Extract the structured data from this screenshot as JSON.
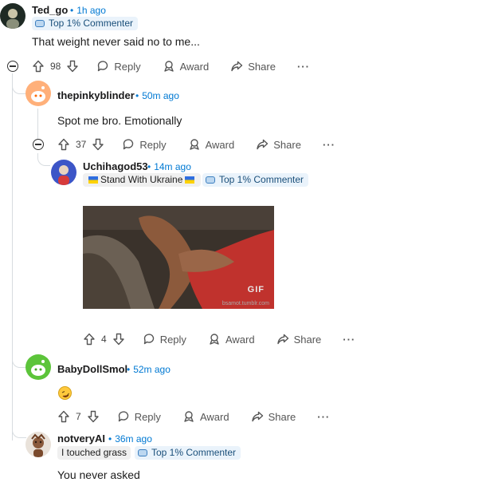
{
  "comments": [
    {
      "username": "Ted_go",
      "time": "1h ago",
      "badge": "Top 1% Commenter",
      "text": "That weight never said no to me...",
      "votes": "98",
      "reply": "Reply",
      "award": "Award",
      "share": "Share",
      "more": "···"
    },
    {
      "username": "thepinkyblinder",
      "time": "50m ago",
      "text": "Spot me bro. Emotionally",
      "votes": "37",
      "reply": "Reply",
      "award": "Award",
      "share": "Share",
      "more": "···"
    },
    {
      "username": "Uchihagod53",
      "time": "14m ago",
      "flair": "Stand With Ukraine",
      "badge": "Top 1% Commenter",
      "gif_label": "GIF",
      "gif_source": "bsamot.tumblr.com",
      "votes": "4",
      "reply": "Reply",
      "award": "Award",
      "share": "Share",
      "more": "···"
    },
    {
      "username": "BabyDollSmol",
      "time": "52m ago",
      "emoji": "rolling-on-floor-laughing-emoji",
      "votes": "7",
      "reply": "Reply",
      "award": "Award",
      "share": "Share",
      "more": "···"
    },
    {
      "username": "notveryAI",
      "time": "36m ago",
      "flair": "I touched grass",
      "badge": "Top 1% Commenter",
      "text": "You never asked"
    }
  ],
  "colors": {
    "time": "#0079d3",
    "badge_bg": "#eaf3fb",
    "thread_line": "#d7dce0"
  },
  "icons": [
    "upvote-icon",
    "downvote-icon",
    "reply-icon",
    "award-icon",
    "share-icon",
    "more-icon",
    "collapse-icon"
  ]
}
